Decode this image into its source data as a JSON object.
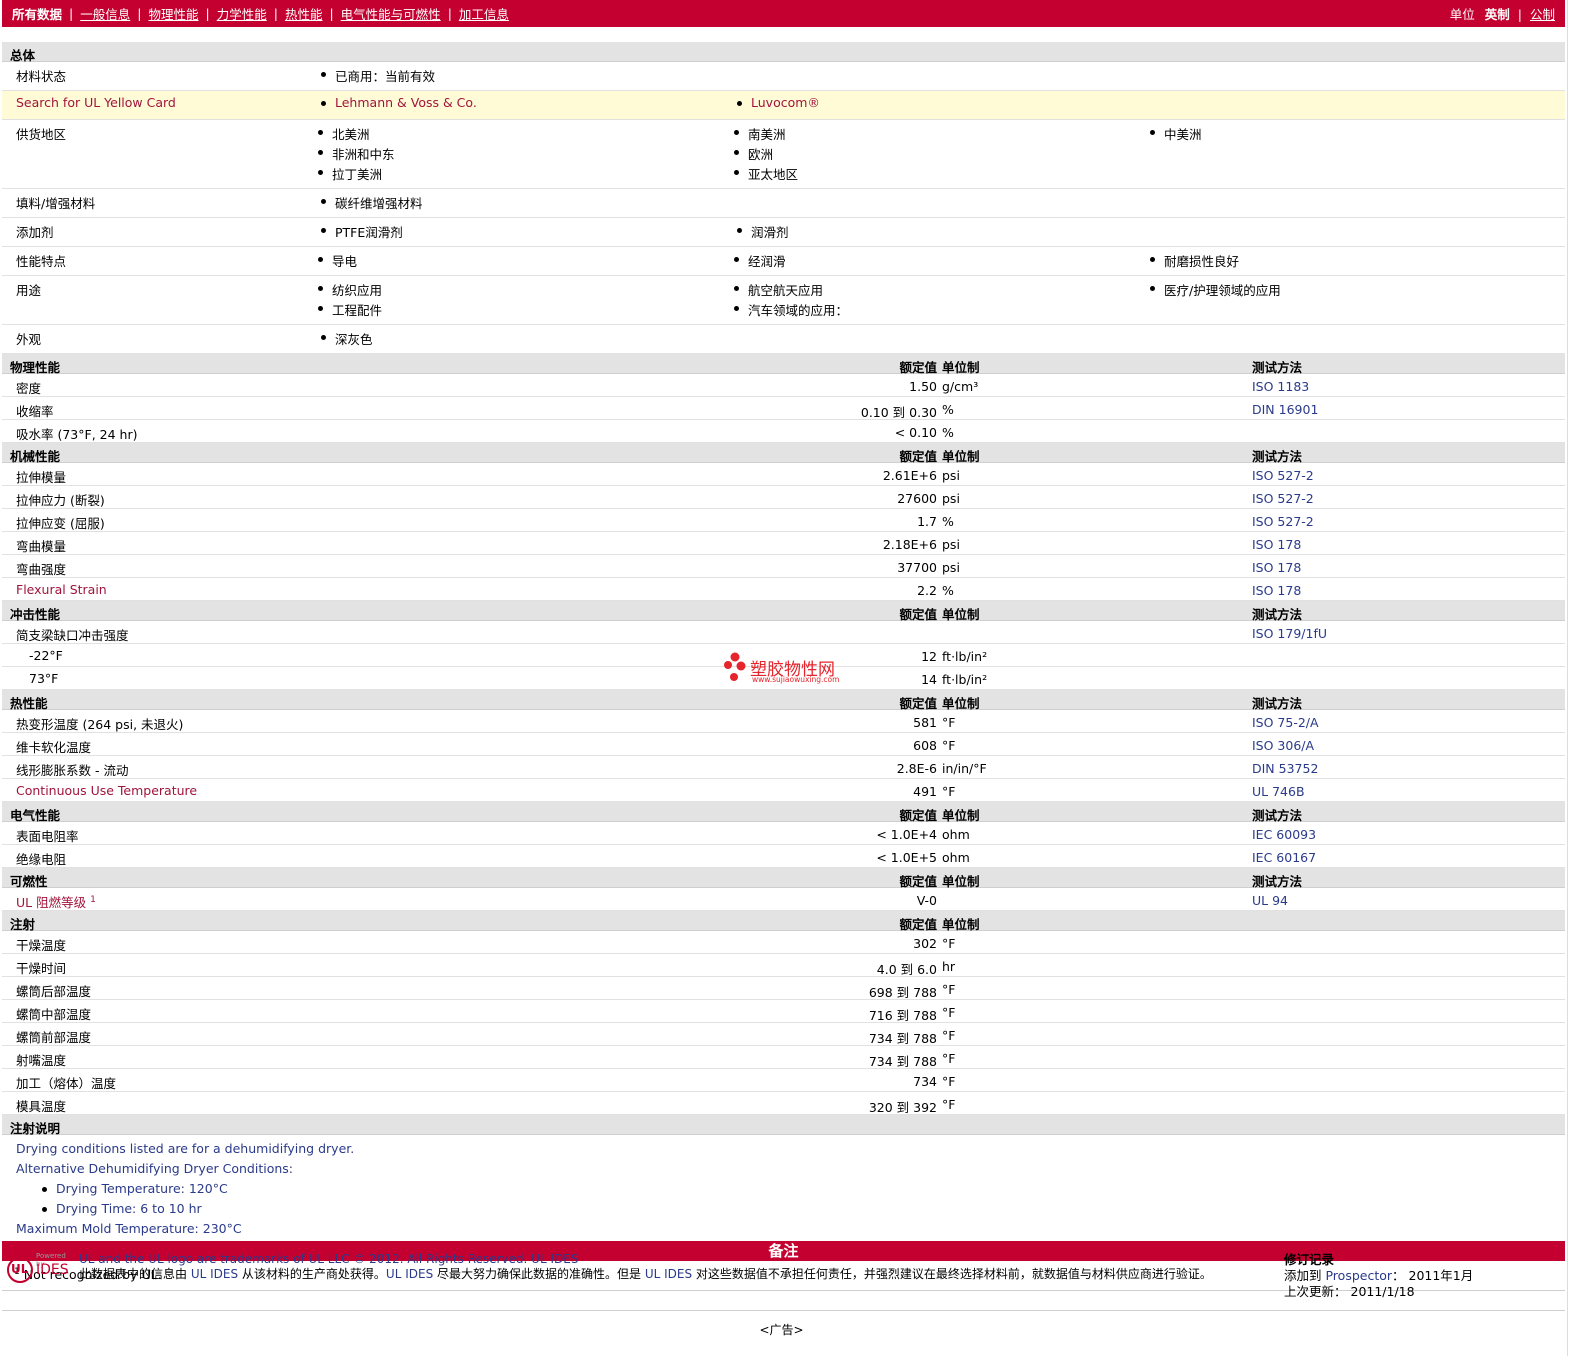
{
  "nav": {
    "items": [
      "所有数据",
      "一般信息",
      "物理性能",
      "力学性能",
      "热性能",
      "电气性能与可燃性",
      "加工信息"
    ],
    "units_label": "单位",
    "unit_current": "英制",
    "unit_other": "公制"
  },
  "general": {
    "title": "总体",
    "rows": [
      {
        "label": "材料状态",
        "cols": [
          [
            "已商用：当前有效"
          ]
        ]
      },
      {
        "label": "Search for UL Yellow Card",
        "highlight": true,
        "cols": [
          [
            "Lehmann & Voss & Co."
          ],
          [
            "Luvocom®"
          ]
        ]
      },
      {
        "label": "供货地区",
        "cols": [
          [
            "北美洲",
            "非洲和中东",
            "拉丁美洲"
          ],
          [
            "南美洲",
            "欧洲",
            "亚太地区"
          ],
          [
            "中美洲"
          ]
        ]
      },
      {
        "label": "填料/增强材料",
        "cols": [
          [
            "碳纤维增强材料"
          ]
        ]
      },
      {
        "label": "添加剂",
        "cols": [
          [
            "PTFE润滑剂"
          ],
          [
            "润滑剂"
          ]
        ]
      },
      {
        "label": "性能特点",
        "cols": [
          [
            "导电"
          ],
          [
            "经润滑"
          ],
          [
            "耐磨损性良好"
          ]
        ]
      },
      {
        "label": "用途",
        "cols": [
          [
            "纺织应用",
            "工程配件"
          ],
          [
            "航空航天应用",
            "汽车领域的应用："
          ],
          [
            "医疗/护理领域的应用"
          ]
        ]
      },
      {
        "label": "外观",
        "cols": [
          [
            "深灰色"
          ]
        ]
      }
    ]
  },
  "headers": {
    "value": "额定值",
    "unit": "单位制",
    "method": "测试方法"
  },
  "sections": [
    {
      "title": "物理性能",
      "method": true,
      "rows": [
        {
          "label": "密度",
          "value": "1.50",
          "unit": "g/cm³",
          "method": "ISO 1183"
        },
        {
          "label": "收缩率",
          "value": "0.10 到  0.30",
          "unit": "%",
          "method": "DIN 16901"
        },
        {
          "label": "吸水率  (73°F, 24 hr)",
          "value": "< 0.10",
          "unit": "%",
          "method": ""
        }
      ]
    },
    {
      "title": "机械性能",
      "method": true,
      "rows": [
        {
          "label": "拉伸模量",
          "value": "2.61E+6",
          "unit": "psi",
          "method": "ISO 527-2"
        },
        {
          "label": "拉伸应力  (断裂)",
          "value": "27600",
          "unit": "psi",
          "method": "ISO 527-2"
        },
        {
          "label": "拉伸应变  (屈服)",
          "value": "1.7",
          "unit": "%",
          "method": "ISO 527-2"
        },
        {
          "label": "弯曲模量",
          "value": "2.18E+6",
          "unit": "psi",
          "method": "ISO 178"
        },
        {
          "label": "弯曲强度",
          "value": "37700",
          "unit": "psi",
          "method": "ISO 178"
        },
        {
          "label": "Flexural Strain",
          "value": "2.2",
          "unit": "%",
          "method": "ISO 178",
          "mfr": true
        }
      ]
    },
    {
      "title": "冲击性能",
      "method": true,
      "rows": [
        {
          "label": "简支梁缺口冲击强度",
          "value": "",
          "unit": "",
          "method": "ISO 179/1fU"
        },
        {
          "label": "-22°F",
          "value": "12",
          "unit": "ft·lb/in²",
          "method": "",
          "sub": true
        },
        {
          "label": "73°F",
          "value": "14",
          "unit": "ft·lb/in²",
          "method": "",
          "sub": true
        }
      ]
    },
    {
      "title": "热性能",
      "method": true,
      "rows": [
        {
          "label": "热变形温度  (264 psi, 未退火)",
          "value": "581",
          "unit": "°F",
          "method": "ISO 75-2/A"
        },
        {
          "label": "维卡软化温度",
          "value": "608",
          "unit": "°F",
          "method": "ISO 306/A"
        },
        {
          "label": "线形膨胀系数   - 流动",
          "value": "2.8E-6",
          "unit": "in/in/°F",
          "method": "DIN 53752"
        },
        {
          "label": "Continuous Use Temperature",
          "value": "491",
          "unit": "°F",
          "method": "UL 746B",
          "mfr": true
        }
      ]
    },
    {
      "title": "电气性能",
      "method": true,
      "rows": [
        {
          "label": "表面电阻率",
          "value": "< 1.0E+4",
          "unit": "ohm",
          "method": "IEC 60093"
        },
        {
          "label": "绝缘电阻",
          "value": "< 1.0E+5",
          "unit": "ohm",
          "method": "IEC 60167"
        }
      ]
    },
    {
      "title": "可燃性",
      "method": true,
      "rows": [
        {
          "label": "UL 阻燃等级",
          "sup": "1",
          "value": "V-0",
          "unit": "",
          "method": "UL 94",
          "mfr": true
        }
      ]
    },
    {
      "title": "注射",
      "method": false,
      "rows": [
        {
          "label": "干燥温度",
          "value": "302",
          "unit": "°F",
          "method": ""
        },
        {
          "label": "干燥时间",
          "value": "4.0 到  6.0",
          "unit": "hr",
          "method": ""
        },
        {
          "label": "螺筒后部温度",
          "value": "698 到  788",
          "unit": "°F",
          "method": ""
        },
        {
          "label": "螺筒中部温度",
          "value": "716 到  788",
          "unit": "°F",
          "method": ""
        },
        {
          "label": "螺筒前部温度",
          "value": "734 到  788",
          "unit": "°F",
          "method": ""
        },
        {
          "label": "射嘴温度",
          "value": "734 到  788",
          "unit": "°F",
          "method": ""
        },
        {
          "label": "加工（熔体）温度",
          "value": "734",
          "unit": "°F",
          "method": ""
        },
        {
          "label": "模具温度",
          "value": "320 到  392",
          "unit": "°F",
          "method": ""
        }
      ]
    }
  ],
  "injection_notes": {
    "title": "注射说明",
    "line1": "Drying conditions listed are for a dehumidifying dryer.",
    "line2": "Alternative Dehumidifying Dryer Conditions:",
    "bullet1": "Drying Temperature: 120°C",
    "bullet2": "Drying Time: 6 to 10 hr",
    "line3": "Maximum Mold Temperature: 230°C"
  },
  "remarks": {
    "title": "备注",
    "footnote_num": "1",
    "footnote_text": "Not recognized by UL."
  },
  "footer": {
    "logo_powered": "Powered by",
    "logo_ul": "UL",
    "logo_ides": "IDES",
    "legal_line1": "UL and the UL logo are trademarks of UL LLC © 2012. All Rights Reserved. ",
    "legal_link": "UL IDES",
    "legal_line2a": "此数据表中的信息由 ",
    "legal_line2b": "UL IDES",
    "legal_line2c": " 从该材料的生产商处获得。",
    "legal_line2d": "UL IDES",
    "legal_line2e": " 尽最大努力确保此数据的准确性。但是 ",
    "legal_line2f": "UL IDES",
    "legal_line2g": " 对这些数据值不承担任何责任，并强烈建议在最终选择材料前，就数据值与材料供应商进行验证。",
    "rev_title": "修订记录",
    "added_label": "添加到  ",
    "added_site": "Prospector",
    "added_date": "：   2011年1月",
    "updated_label": "上次更新：",
    "updated_date": "    2011/1/18"
  },
  "ad": "<广告>",
  "watermark": {
    "text": "塑胶物性网",
    "url": "www.sujiaowuxing.com"
  }
}
